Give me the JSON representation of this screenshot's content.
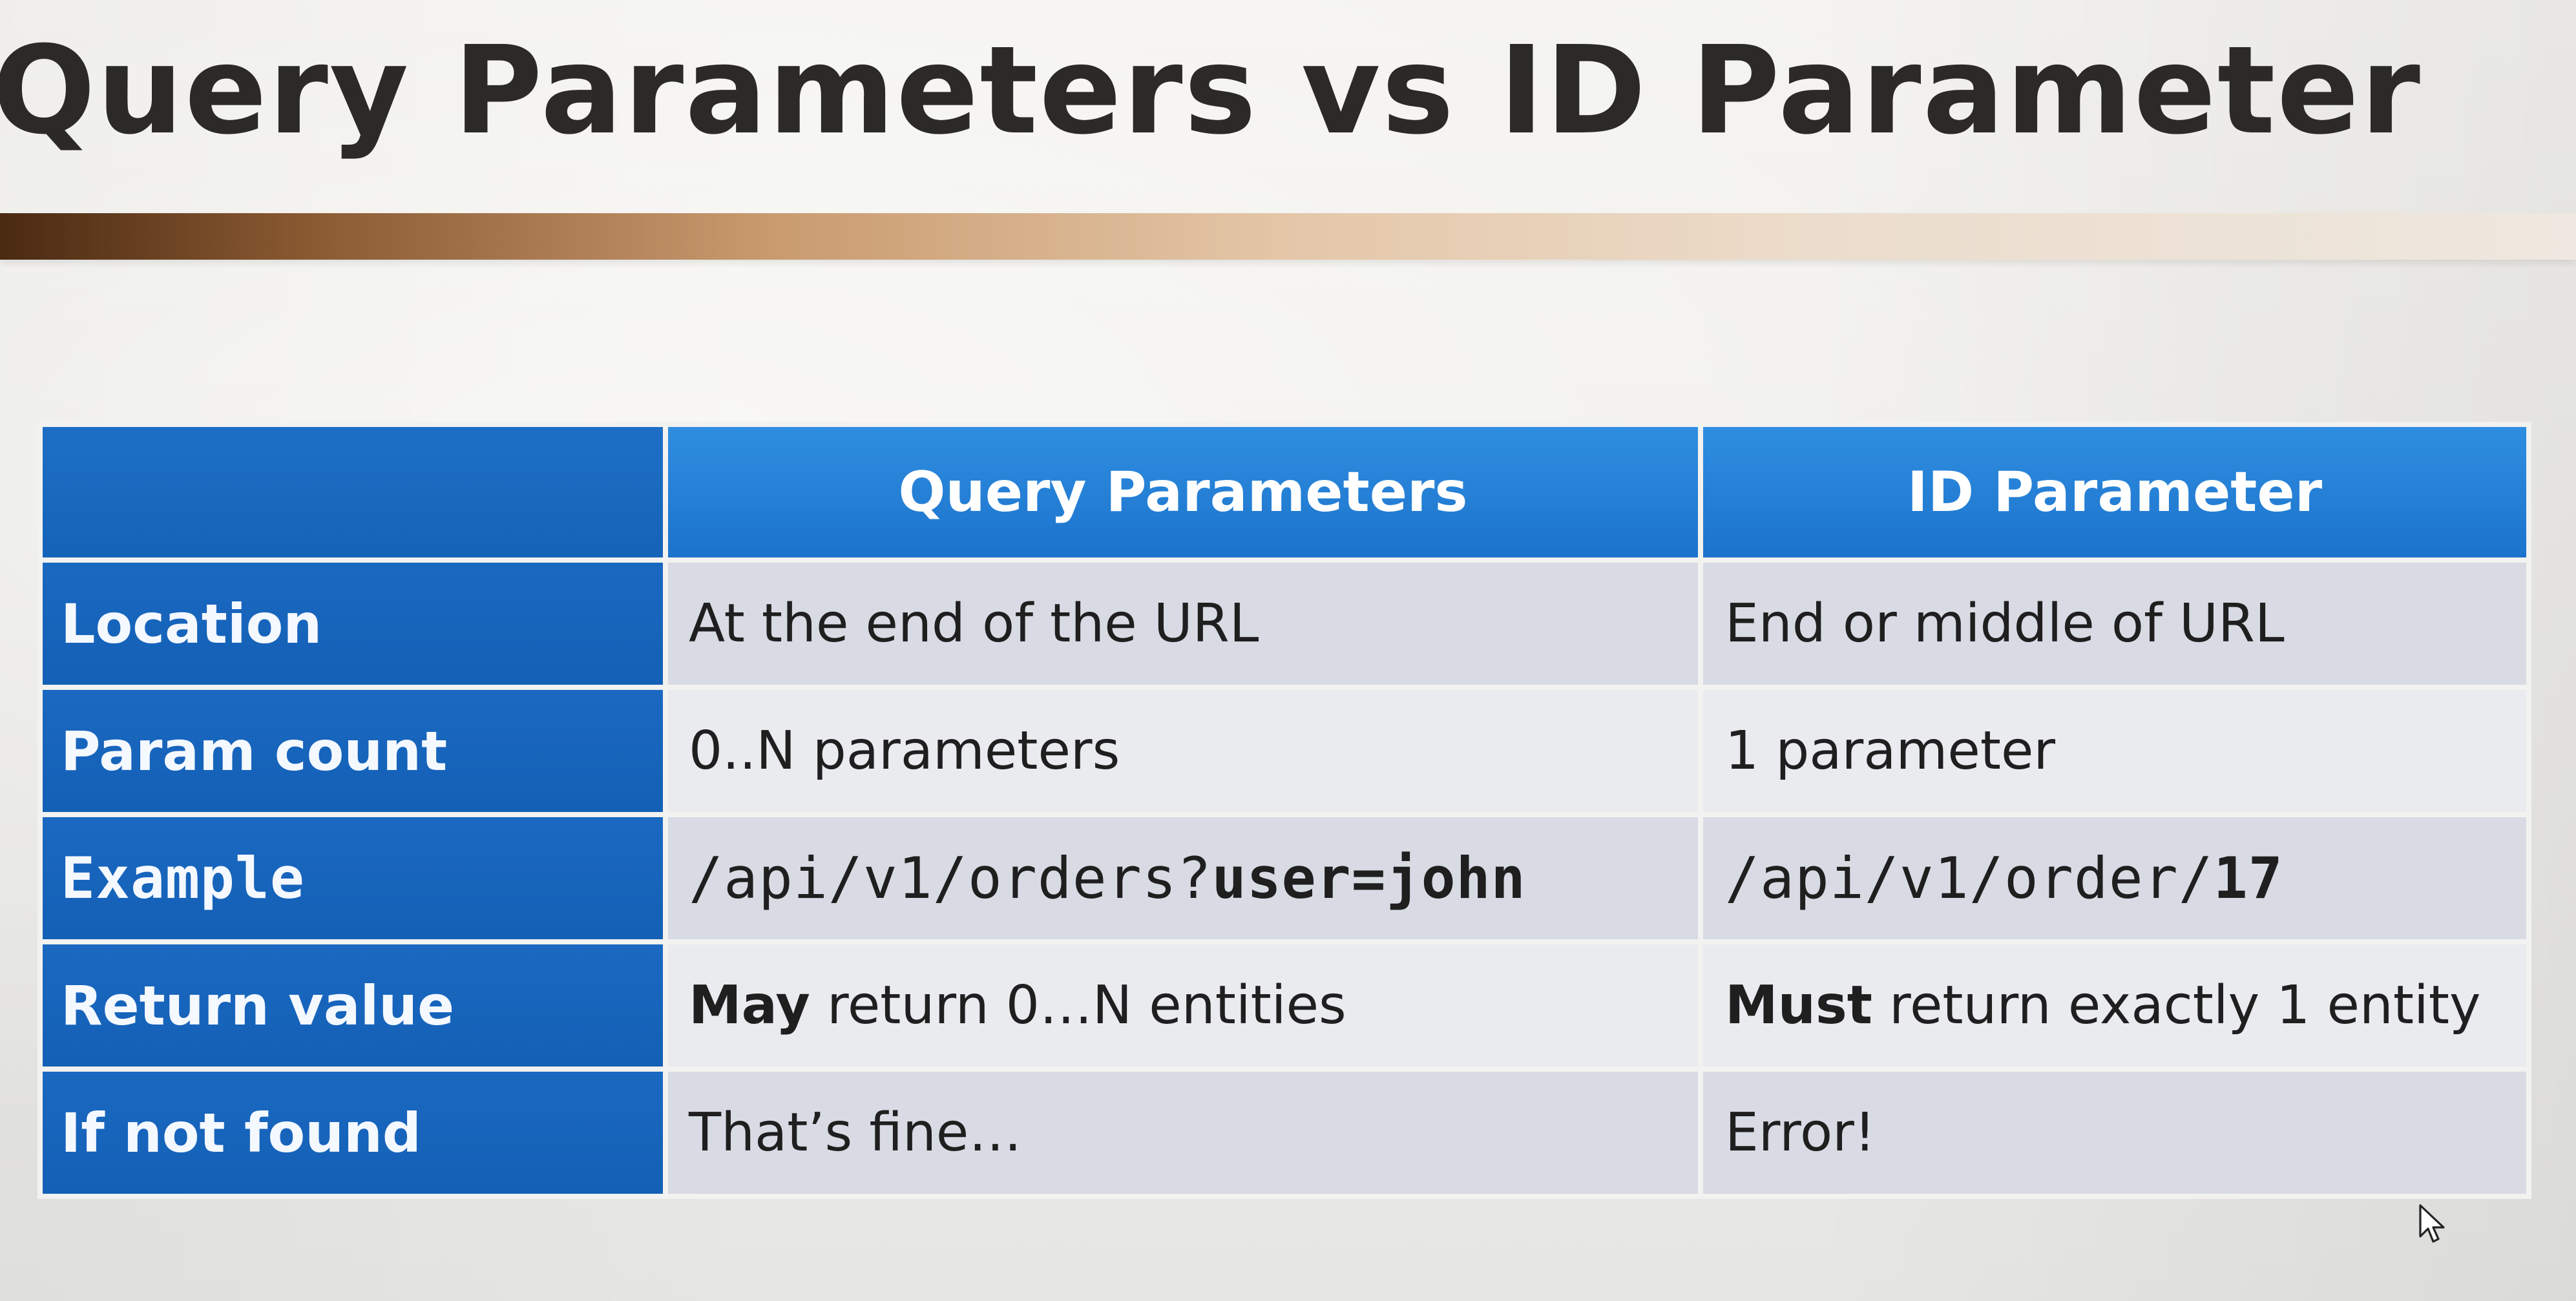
{
  "slide": {
    "title": "Query Parameters vs ID Parameter"
  },
  "table": {
    "columns": [
      "",
      "Query Parameters",
      "ID Parameter"
    ],
    "rows": [
      {
        "label": "Location",
        "query": "At the end of the URL",
        "id": "End or middle of URL"
      },
      {
        "label": "Param count",
        "query": "0..N parameters",
        "id": "1 parameter"
      },
      {
        "label": "Example",
        "query_prefix": "/api/v1/orders?",
        "query_bold": "user=john",
        "id_prefix": "/api/v1/order/",
        "id_bold": "17"
      },
      {
        "label": "Return value",
        "query_bold": "May",
        "query_rest": " return 0…N entities",
        "id_bold": "Must",
        "id_rest": " return exactly 1 entity"
      },
      {
        "label": "If not found",
        "query": "That’s fine…",
        "id": "Error!"
      }
    ]
  },
  "icons": {
    "cursor": "mouse-pointer-icon"
  },
  "colors": {
    "header_blue": "#2f8ee0",
    "row_label_blue": "#1a68c1",
    "title_text": "#2b2a27",
    "rule_dark": "#4a2a12"
  }
}
